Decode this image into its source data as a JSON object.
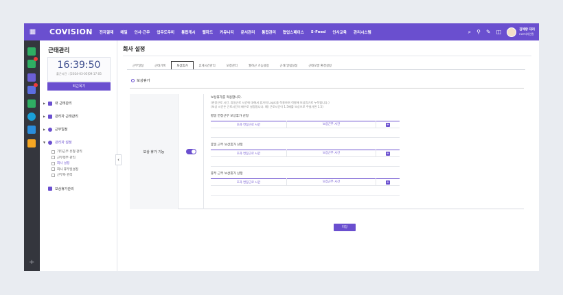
{
  "topbar": {
    "logo": "COVISION",
    "nav": [
      "전자결재",
      "메일",
      "인사·근무",
      "업무도우미",
      "통합게시",
      "웹하드",
      "커뮤니티",
      "문서관리",
      "통합관리",
      "협업스페이스",
      "S-Feed",
      "인사교육",
      "관리시스템"
    ],
    "user_name": "김혜랑 대리",
    "user_dept": "E2E자사인원",
    "icons": [
      "search-icon",
      "person-icon",
      "edit-icon",
      "window-icon"
    ]
  },
  "sidebar": {
    "title": "근태관리",
    "clock": "16:39:50",
    "clock_sub": "출근시간 : [2024-03-05]09:17:05",
    "punch_label": "퇴근목기",
    "menu": [
      {
        "label": "내 근태관리"
      },
      {
        "label": "관리자 근태관리"
      },
      {
        "label": "근무일정"
      },
      {
        "label": "관리자 설정"
      }
    ],
    "submenu": [
      "기타근무 유형 관리",
      "근무정부 관리",
      "회사 설정",
      "회사 휴무일설정",
      "근무자 관리"
    ],
    "extra": "보상휴가관리"
  },
  "main": {
    "title": "회사 설정",
    "tabs": [
      "근무일정",
      "근태기록",
      "보상휴가",
      "휴게시간관리",
      "모청관리",
      "월허근 기능설정",
      "근태 알림설정",
      "근태모발 환경설정"
    ],
    "active_tab": 2,
    "section_title": "보상휴가",
    "row_label": "보상 휴가 기능",
    "toggle_on": true,
    "desc1": "보상휴가를 적용합니다.",
    "desc2": "(연장근로 시간, 휴일근로 시간에 대해서 휴가의 Logic을 적용하여 적절해 보상휴가로 누적됩니다.)",
    "desc3": "(보상 시간은 근로시간의 배수로 설정됩니다. 예) 근로시간이 1.5배를 보상으로 주설가면 1.5)",
    "groups": [
      {
        "title": "평일 연장근무 보상휴가 산정",
        "col1": "초과 연장근로 시간",
        "col2": "보상근무 시간"
      },
      {
        "title": "휴일 근무 보상휴가 산정",
        "col1": "초과 연장근로 시간",
        "col2": "보상근무 시간"
      },
      {
        "title": "휴무 근무 보상휴가 산정",
        "col1": "초과 연장근로 시간",
        "col2": "보상근무 시간"
      }
    ],
    "save_label": "저장"
  },
  "colors": {
    "accent": "#6a4fcf",
    "rail": "#34363d"
  }
}
